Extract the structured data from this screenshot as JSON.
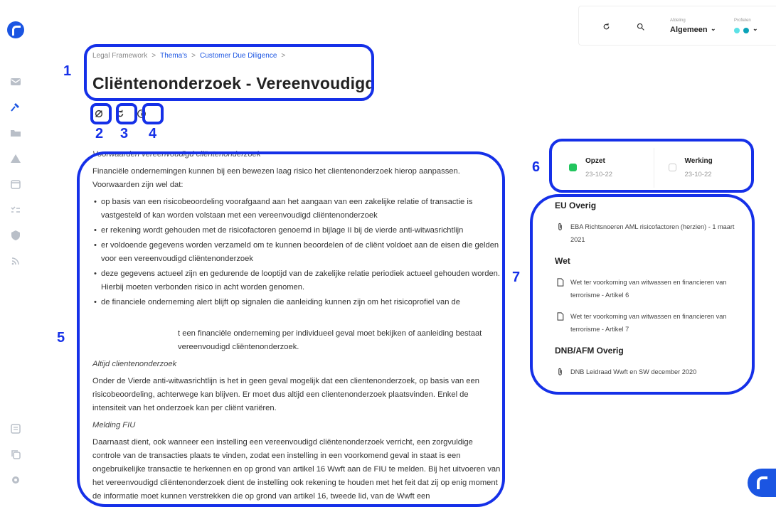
{
  "sidebar": {
    "icons": [
      "mail-icon",
      "hammer-icon",
      "folder-icon",
      "warning-icon",
      "calendar-icon",
      "checklist-icon",
      "shield-icon",
      "rss-icon",
      "document-icon",
      "copy-icon",
      "gear-icon"
    ]
  },
  "topbar": {
    "afdeling_label": "Afdeling",
    "afdeling_value": "Algemeen",
    "profielen_label": "Profielen"
  },
  "breadcrumb": {
    "items": [
      "Legal Framework",
      "Thema's",
      "Customer Due Diligence"
    ],
    "separator": ">"
  },
  "page": {
    "title": "Cliëntenonderzoek - Vereenvoudigd"
  },
  "content": {
    "heading1": "Voorwaarden vereenvoudigd cliëntenonderzoek",
    "intro": "Financiële ondernemingen kunnen bij een bewezen laag risico het clientenonderzoek hierop aanpassen. Voorwaarden zijn wel dat:",
    "bullets": [
      "op basis van een risicobeoordeling voorafgaand aan het aangaan van een zakelijke relatie of transactie is vastgesteld of kan worden volstaan met een vereenvoudigd cliëntenonderzoek",
      "er rekening wordt gehouden met de risicofactoren genoemd in bijlage II bij de vierde anti-witwasrichtlijn",
      "er voldoende gegevens worden verzameld om te kunnen beoordelen of de cliënt voldoet aan de eisen die gelden voor een vereenvoudigd cliëntenonderzoek",
      "deze gegevens actueel zijn en gedurende de looptijd van de zakelijke relatie periodiek actueel gehouden worden. Hierbij moeten verbonden risico in acht worden genomen.",
      "de financiele onderneming alert blijft op signalen die aanleiding kunnen zijn om het risicoprofiel van de"
    ],
    "para_partial_1": "t een financiële onderneming per individueel geval moet bekijken of aanleiding bestaat",
    "para_partial_2": "vereenvoudigd cliëntenonderzoek.",
    "heading2": "Altijd clientenonderzoek",
    "para2": "Onder de Vierde anti-witwasrichtlijn is het in geen geval mogelijk dat een clientenonderzoek, op basis van een risicobeoordeling, achterwege kan blijven. Er moet dus altijd een clientenonderzoek plaatsvinden. Enkel de intensiteit van het onderzoek kan per cliënt variëren.",
    "heading3": "Melding FIU",
    "para3": "Daarnaast dient, ook wanneer een instelling een vereenvoudigd cliëntenonderzoek verricht, een zorgvuldige controle van de transacties plaats te vinden, zodat een instelling in een voorkomend geval in staat is een ongebruikelijke transactie te herkennen en op grond van artikel 16 Wwft aan de FIU te melden. Bij het uitvoeren van het vereenvoudigd cliëntenonderzoek dient de instelling ook rekening te houden met het feit dat zij op enig moment de informatie moet kunnen verstrekken die op grond van artikel 16, tweede lid, van de Wwft een"
  },
  "status": {
    "items": [
      {
        "label": "Opzet",
        "date": "23-10-22",
        "color": "#22c55e"
      },
      {
        "label": "Werking",
        "date": "23-10-22",
        "color": "#ffffff"
      }
    ]
  },
  "documents": {
    "sections": [
      {
        "title": "EU Overig",
        "items": [
          {
            "icon": "paperclip-icon",
            "text": "EBA Richtsnoeren AML risicofactoren (herzien) - 1 maart 2021"
          }
        ]
      },
      {
        "title": "Wet",
        "items": [
          {
            "icon": "file-icon",
            "text": "Wet ter voorkoming van witwassen en financieren van terrorisme - Artikel 6"
          },
          {
            "icon": "file-icon",
            "text": "Wet ter voorkoming van witwassen en financieren van terrorisme - Artikel 7"
          }
        ]
      },
      {
        "title": "DNB/AFM Overig",
        "items": [
          {
            "icon": "paperclip-icon",
            "text": "DNB Leidraad Wwft en SW december 2020"
          }
        ]
      }
    ]
  },
  "annotations": [
    "1",
    "2",
    "3",
    "4",
    "5",
    "6",
    "7"
  ],
  "colors": {
    "accent": "#1b55e2",
    "annotation": "#1530e8",
    "profile_dot_1": "#5ce1e6",
    "profile_dot_2": "#0aa3b8"
  }
}
